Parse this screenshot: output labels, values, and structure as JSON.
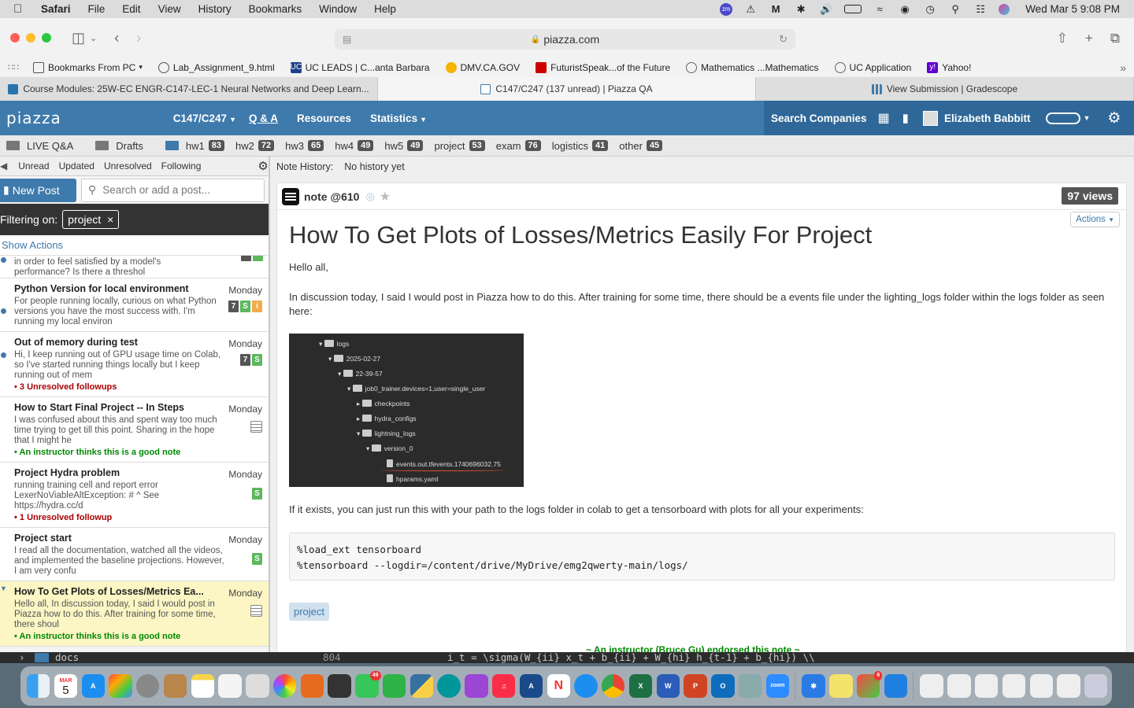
{
  "menubar": {
    "app": "Safari",
    "items": [
      "File",
      "Edit",
      "View",
      "History",
      "Bookmarks",
      "Window",
      "Help"
    ],
    "clock": "Wed Mar 5  9:08 PM",
    "status_icons": [
      "zoom-icon",
      "alert-icon",
      "malwarebytes-icon",
      "bluetooth-icon",
      "volume-icon",
      "battery-icon",
      "wifi-icon",
      "user-icon",
      "time-machine-icon",
      "search-icon",
      "control-center-icon",
      "siri-icon"
    ]
  },
  "browser": {
    "url": "piazza.com",
    "bookmarks": [
      "Bookmarks From PC",
      "Lab_Assignment_9.html",
      "UC LEADS | C...anta Barbara",
      "DMV.CA.GOV",
      "FuturistSpeak...of the Future",
      "Mathematics ...Mathematics",
      "UC Application",
      "Yahoo!"
    ],
    "tabs": [
      {
        "label": "Course Modules: 25W-EC ENGR-C147-LEC-1 Neural Networks and Deep Learn...",
        "active": false
      },
      {
        "label": "C147/C247 (137 unread) | Piazza QA",
        "active": true
      },
      {
        "label": "View Submission | Gradescope",
        "active": false
      }
    ]
  },
  "piazza": {
    "logo": "piazza",
    "course": "C147/C247",
    "nav": {
      "qa": "Q & A",
      "resources": "Resources",
      "statistics": "Statistics"
    },
    "search_companies": "Search Companies",
    "user": "Elizabeth Babbitt",
    "folders": {
      "live": "LIVE Q&A",
      "drafts": "Drafts",
      "items": [
        {
          "name": "hw1",
          "count": "83"
        },
        {
          "name": "hw2",
          "count": "72"
        },
        {
          "name": "hw3",
          "count": "65"
        },
        {
          "name": "hw4",
          "count": "49"
        },
        {
          "name": "hw5",
          "count": "49"
        },
        {
          "name": "project",
          "count": "53"
        },
        {
          "name": "exam",
          "count": "76"
        },
        {
          "name": "logistics",
          "count": "41"
        },
        {
          "name": "other",
          "count": "45"
        }
      ]
    },
    "filters": [
      "Unread",
      "Updated",
      "Unresolved",
      "Following"
    ],
    "new_post": "New Post",
    "search_placeholder": "Search or add a post...",
    "filtering_on": "Filtering on:",
    "filter_chip": "project",
    "show_actions": "Show Actions",
    "partial_post": "in order to feel satisfied by a model's performance? Is there a threshol",
    "posts": [
      {
        "title": "Python Version for local environment",
        "body": "For people running locally, curious on what Python versions you have the most success with. I'm running my local environ",
        "date": "Monday",
        "followup": "",
        "badges": [
          "7",
          "S",
          "i"
        ]
      },
      {
        "title": "Out of memory during test",
        "body": "Hi, I keep running out of GPU usage time on Colab, so I've started running things locally but I keep running out of mem",
        "date": "Monday",
        "followup": "3 Unresolved followups",
        "badges": [
          "7",
          "S"
        ]
      },
      {
        "title": "How to Start Final Project -- In Steps",
        "body": "I was confused about this and spent way too much time trying to get till this point. Sharing in the hope that I might he",
        "date": "Monday",
        "followup": "An instructor thinks this is a good note",
        "badges": []
      },
      {
        "title": "Project Hydra problem",
        "body": "running training cell and report error LexerNoViableAltException: # ^ See https://hydra.cc/d",
        "date": "Monday",
        "followup": "1 Unresolved followup",
        "badges": [
          "S"
        ]
      },
      {
        "title": "Project start",
        "body": "I read all the documentation, watched all the videos, and implemented the baseline projections. However, I am very confu",
        "date": "Monday",
        "followup": "",
        "badges": [
          "S"
        ]
      },
      {
        "title": "How To Get Plots of Losses/Metrics Ea...",
        "body": "Hello all, In discussion today, I said I would post in Piazza how to do this. After training for some time, there shoul",
        "date": "Monday",
        "followup": "An instructor thinks this is a good note",
        "badges": []
      }
    ],
    "note": {
      "history_label": "Note History:",
      "history_value": "No history yet",
      "label": "note @610",
      "views": "97 views",
      "actions": "Actions",
      "title": "How To Get Plots of Losses/Metrics Easily For Project",
      "greeting": "Hello all,",
      "p1": "In discussion today, I said I would post in Piazza how to do this. After training for some time, there should be a events file under the lighting_logs folder within the logs folder as seen here:",
      "p2": "If it exists, you can just run this with your path to the logs folder in colab to get a tensorboard with plots for all your experiments:",
      "code1": "%load_ext tensorboard",
      "code2": "%tensorboard --logdir=/content/drive/MyDrive/emg2qwerty-main/logs/",
      "tag": "project",
      "endorse": "~ An instructor (Bruce Gu) endorsed this note ~",
      "filetree": [
        "logs",
        "2025-02-27",
        "22-39-57",
        "job0_trainer.devices=1,user=single_user",
        "checkpoints",
        "hydra_configs",
        "lightning_logs",
        "version_0",
        "events.out.tfevents.1740696032.75",
        "hparams.yaml"
      ]
    }
  },
  "terminal": {
    "folder": "docs",
    "line_no": "804",
    "code": "i_t = \\sigma(W_{ii} x_t + b_{ii} + W_{hi} h_{t-1} + b_{hi}) \\\\"
  },
  "dock": {
    "calendar_month": "MAR",
    "calendar_day": "5",
    "messages_badge": "49",
    "badge_6": "6"
  }
}
